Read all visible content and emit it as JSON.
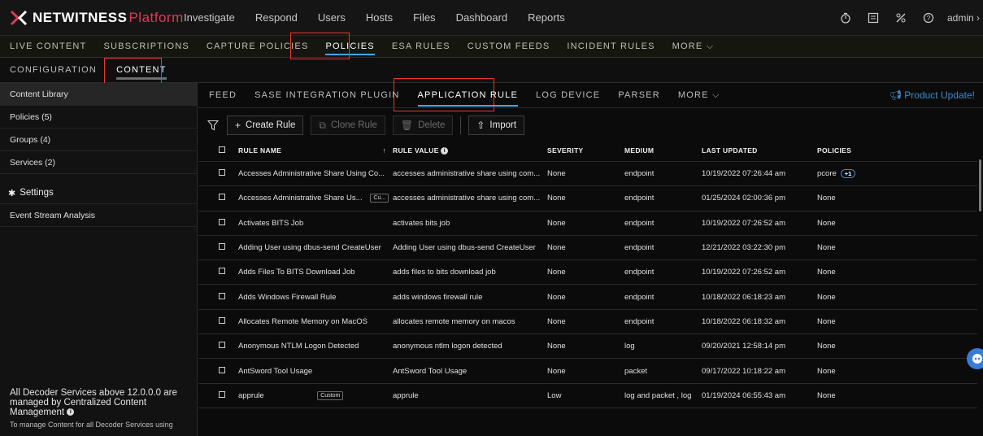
{
  "brand": {
    "name": "NETWITNESS",
    "product": "Platform"
  },
  "top_nav": [
    "Investigate",
    "Respond",
    "Users",
    "Hosts",
    "Files",
    "Dashboard",
    "Reports"
  ],
  "user": {
    "label": "admin ›"
  },
  "sub_nav": [
    "LIVE CONTENT",
    "SUBSCRIPTIONS",
    "CAPTURE POLICIES",
    "POLICIES",
    "ESA RULES",
    "CUSTOM FEEDS",
    "INCIDENT RULES",
    "MORE ⌵"
  ],
  "sub_nav2": [
    "CONFIGURATION",
    "CONTENT"
  ],
  "sidebar": {
    "items": [
      "Content Library",
      "Policies (5)",
      "Groups (4)",
      "Services (2)"
    ],
    "settings_label": "Settings",
    "settings_items": [
      "Event Stream Analysis"
    ],
    "note_title": "All Decoder Services above 12.0.0.0 are managed by Centralized Content Management",
    "note_body": "To manage Content for all Decoder Services using"
  },
  "tabs": [
    "FEED",
    "SASE INTEGRATION PLUGIN",
    "APPLICATION RULE",
    "LOG DEVICE",
    "PARSER",
    "MORE ⌵"
  ],
  "product_update": "Product Update!",
  "toolbar": {
    "create": "Create Rule",
    "clone": "Clone Rule",
    "delete": "Delete",
    "import": "Import"
  },
  "columns": [
    "RULE NAME",
    "RULE VALUE",
    "SEVERITY",
    "MEDIUM",
    "LAST UPDATED",
    "POLICIES"
  ],
  "rows": [
    {
      "name": "Accesses Administrative Share Using Co...",
      "tag": "",
      "value": "accesses administrative share using com...",
      "severity": "None",
      "medium": "endpoint",
      "updated": "10/19/2022 07:26:44 am",
      "policies": "pcore",
      "extra": "+1"
    },
    {
      "name": "Accesses Administrative Share Us...",
      "tag": "Cu...",
      "value": "accesses administrative share using com...",
      "severity": "None",
      "medium": "endpoint",
      "updated": "01/25/2024 02:00:36 pm",
      "policies": "None",
      "extra": ""
    },
    {
      "name": "Activates BITS Job",
      "tag": "",
      "value": "activates bits job",
      "severity": "None",
      "medium": "endpoint",
      "updated": "10/19/2022 07:26:52 am",
      "policies": "None",
      "extra": ""
    },
    {
      "name": "Adding User using dbus-send CreateUser",
      "tag": "",
      "value": "Adding User using dbus-send CreateUser",
      "severity": "None",
      "medium": "endpoint",
      "updated": "12/21/2022 03:22:30 pm",
      "policies": "None",
      "extra": ""
    },
    {
      "name": "Adds Files To BITS Download Job",
      "tag": "",
      "value": "adds files to bits download job",
      "severity": "None",
      "medium": "endpoint",
      "updated": "10/19/2022 07:26:52 am",
      "policies": "None",
      "extra": ""
    },
    {
      "name": "Adds Windows Firewall Rule",
      "tag": "",
      "value": "adds windows firewall rule",
      "severity": "None",
      "medium": "endpoint",
      "updated": "10/18/2022 06:18:23 am",
      "policies": "None",
      "extra": ""
    },
    {
      "name": "Allocates Remote Memory on MacOS",
      "tag": "",
      "value": "allocates remote memory on macos",
      "severity": "None",
      "medium": "endpoint",
      "updated": "10/18/2022 06:18:32 am",
      "policies": "None",
      "extra": ""
    },
    {
      "name": "Anonymous NTLM Logon Detected",
      "tag": "",
      "value": "anonymous ntlm logon detected",
      "severity": "None",
      "medium": "log",
      "updated": "09/20/2021 12:58:14 pm",
      "policies": "None",
      "extra": ""
    },
    {
      "name": "AntSword Tool Usage",
      "tag": "",
      "value": "AntSword Tool Usage",
      "severity": "None",
      "medium": "packet",
      "updated": "09/17/2022 10:18:22 am",
      "policies": "None",
      "extra": ""
    },
    {
      "name": "apprule",
      "tag": "Custom",
      "value": "apprule",
      "severity": "Low",
      "medium": "log and packet , log",
      "updated": "01/19/2024 06:55:43 am",
      "policies": "None",
      "extra": ""
    }
  ]
}
